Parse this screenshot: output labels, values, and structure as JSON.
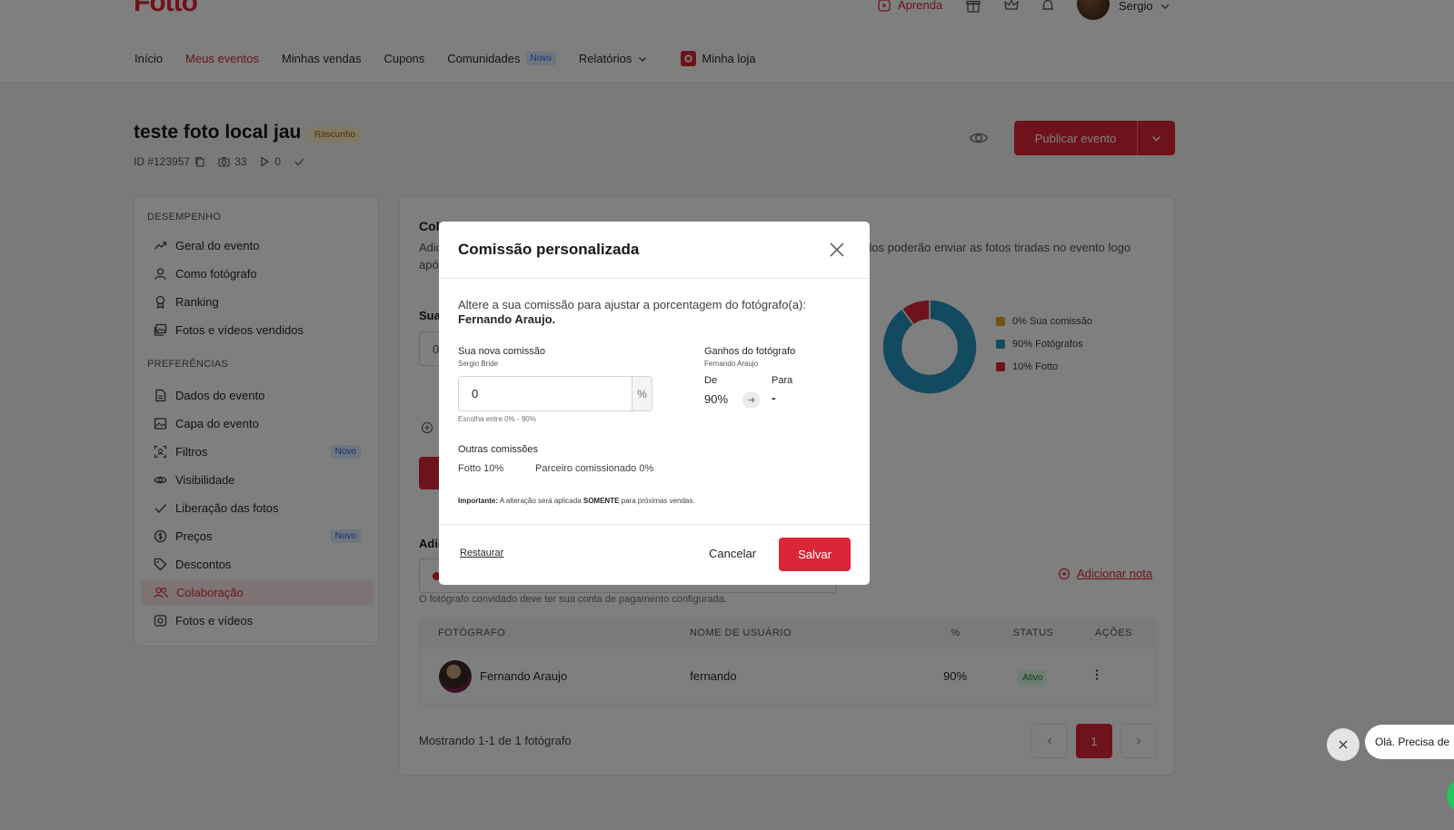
{
  "header": {
    "logo": "Fotto",
    "aprenda": "Aprenda",
    "user_name": "Sergio",
    "nav": [
      {
        "label": "Início"
      },
      {
        "label": "Meus eventos"
      },
      {
        "label": "Minhas vendas"
      },
      {
        "label": "Cupons"
      },
      {
        "label": "Comunidades",
        "badge": "Novo"
      },
      {
        "label": "Relatórios"
      },
      {
        "label": "Minha loja"
      }
    ]
  },
  "event": {
    "title": "teste foto local jau",
    "status": "Rascunho",
    "id": "ID #123957",
    "photos": "33",
    "videos": "0",
    "publish_label": "Publicar evento"
  },
  "sidebar": {
    "desempenho_title": "DESEMPENHO",
    "preferencias_title": "PREFERÊNCIAS",
    "desempenho": [
      {
        "label": "Geral do evento"
      },
      {
        "label": "Como fotógrafo"
      },
      {
        "label": "Ranking"
      },
      {
        "label": "Fotos e vídeos vendidos"
      }
    ],
    "preferencias": [
      {
        "label": "Dados do evento"
      },
      {
        "label": "Capa do evento"
      },
      {
        "label": "Filtros",
        "badge": "Novo"
      },
      {
        "label": "Visibilidade"
      },
      {
        "label": "Liberação das fotos"
      },
      {
        "label": "Preços",
        "badge": "Novo"
      },
      {
        "label": "Descontos"
      },
      {
        "label": "Colaboração"
      },
      {
        "label": "Fotos e vídeos"
      }
    ]
  },
  "main": {
    "title": "Col",
    "desc_left": "Adic",
    "desc_left2": "apó",
    "desc_right": "nvidados poderão enviar as fotos tiradas no evento logo",
    "sua_label": "Sua",
    "sua_value": "0",
    "adic_label": "Adic",
    "add_note": "Adicionar nota",
    "hint": "O fotógrafo convidado deve ter sua conta de pagamento configurada.",
    "legend": [
      {
        "label": "0% Sua comissão",
        "color": "#e5a323"
      },
      {
        "label": "90% Fotógrafos",
        "color": "#2596be"
      },
      {
        "label": "10% Fotto",
        "color": "#dc2637"
      }
    ],
    "table": {
      "headers": [
        "FOTÓGRAFO",
        "NOME DE USUÁRIO",
        "%",
        "STATUS",
        "AÇÕES"
      ],
      "rows": [
        {
          "name": "Fernando Araujo",
          "username": "fernando",
          "pct": "90%",
          "status": "Ativo"
        }
      ]
    },
    "showing": "Mostrando 1-1 de 1 fotógrafo",
    "page": "1"
  },
  "chart_data": {
    "type": "pie",
    "categories": [
      "Sua comissão",
      "Fotógrafos",
      "Fotto"
    ],
    "values": [
      0,
      90,
      10
    ],
    "colors": [
      "#e5a323",
      "#2596be",
      "#dc2637"
    ],
    "legend_position": "right"
  },
  "modal": {
    "title": "Comissão personalizada",
    "desc": "Altere a sua comissão para ajustar a porcentagem do fotógrafo(a):",
    "photographer": "Fernando Araujo.",
    "new_commission_label": "Sua nova comissão",
    "new_commission_sub": "Sergio Bride",
    "input_value": "0",
    "input_unit": "%",
    "range_hint": "Escolha entre 0% - 90%",
    "earnings_label": "Ganhos do fotógrafo",
    "earnings_sub": "Fernando Araujo",
    "from_label": "De",
    "to_label": "Para",
    "from_value": "90%",
    "to_value": "-",
    "other_label": "Outras comissões",
    "fotto_commission": "Fotto 10%",
    "partner_commission": "Parceiro comissionado 0%",
    "important_label": "Importante:",
    "important_text1": "A alteração será aplicada",
    "important_bold": "SOMENTE",
    "important_text2": "para próximas vendas.",
    "restore_label": "Restaurar",
    "cancel_label": "Cancelar",
    "save_label": "Salvar"
  },
  "chat": {
    "greeting": "Olá. Precisa de"
  }
}
